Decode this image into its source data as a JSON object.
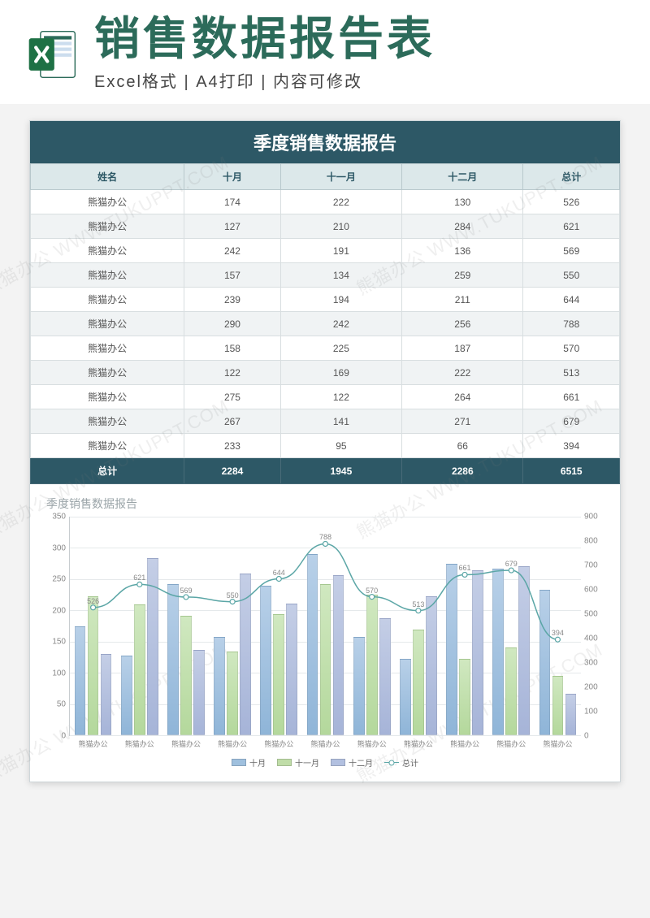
{
  "header": {
    "main_title": "销售数据报告表",
    "sub_title": "Excel格式 | A4打印 | 内容可修改"
  },
  "sheet": {
    "title": "季度销售数据报告",
    "columns": [
      "姓名",
      "十月",
      "十一月",
      "十二月",
      "总计"
    ],
    "rows": [
      {
        "name": "熊猫办公",
        "oct": 174,
        "nov": 222,
        "dec": 130,
        "total": 526
      },
      {
        "name": "熊猫办公",
        "oct": 127,
        "nov": 210,
        "dec": 284,
        "total": 621
      },
      {
        "name": "熊猫办公",
        "oct": 242,
        "nov": 191,
        "dec": 136,
        "total": 569
      },
      {
        "name": "熊猫办公",
        "oct": 157,
        "nov": 134,
        "dec": 259,
        "total": 550
      },
      {
        "name": "熊猫办公",
        "oct": 239,
        "nov": 194,
        "dec": 211,
        "total": 644
      },
      {
        "name": "熊猫办公",
        "oct": 290,
        "nov": 242,
        "dec": 256,
        "total": 788
      },
      {
        "name": "熊猫办公",
        "oct": 158,
        "nov": 225,
        "dec": 187,
        "total": 570
      },
      {
        "name": "熊猫办公",
        "oct": 122,
        "nov": 169,
        "dec": 222,
        "total": 513
      },
      {
        "name": "熊猫办公",
        "oct": 275,
        "nov": 122,
        "dec": 264,
        "total": 661
      },
      {
        "name": "熊猫办公",
        "oct": 267,
        "nov": 141,
        "dec": 271,
        "total": 679
      },
      {
        "name": "熊猫办公",
        "oct": 233,
        "nov": 95,
        "dec": 66,
        "total": 394
      }
    ],
    "footer": {
      "label": "总计",
      "oct": 2284,
      "nov": 1945,
      "dec": 2286,
      "total": 6515
    }
  },
  "chart_data": {
    "type": "bar",
    "title": "季度销售数据报告",
    "categories": [
      "熊猫办公",
      "熊猫办公",
      "熊猫办公",
      "熊猫办公",
      "熊猫办公",
      "熊猫办公",
      "熊猫办公",
      "熊猫办公",
      "熊猫办公",
      "熊猫办公",
      "熊猫办公"
    ],
    "series": [
      {
        "name": "十月",
        "values": [
          174,
          127,
          242,
          157,
          239,
          290,
          158,
          122,
          275,
          267,
          233
        ],
        "axis": "left"
      },
      {
        "name": "十一月",
        "values": [
          222,
          210,
          191,
          134,
          194,
          242,
          225,
          169,
          122,
          141,
          95
        ],
        "axis": "left"
      },
      {
        "name": "十二月",
        "values": [
          130,
          284,
          136,
          259,
          211,
          256,
          187,
          222,
          264,
          271,
          66
        ],
        "axis": "left"
      },
      {
        "name": "总计",
        "values": [
          526,
          621,
          569,
          550,
          644,
          788,
          570,
          513,
          661,
          679,
          394
        ],
        "axis": "right",
        "type": "line"
      }
    ],
    "y_left": {
      "min": 0,
      "max": 350,
      "step": 50
    },
    "y_right": {
      "min": 0,
      "max": 900,
      "step": 100
    },
    "legend": [
      "十月",
      "十一月",
      "十二月",
      "总计"
    ]
  },
  "watermark_text": "熊猫办公 WWW.TUKUPPT.COM"
}
